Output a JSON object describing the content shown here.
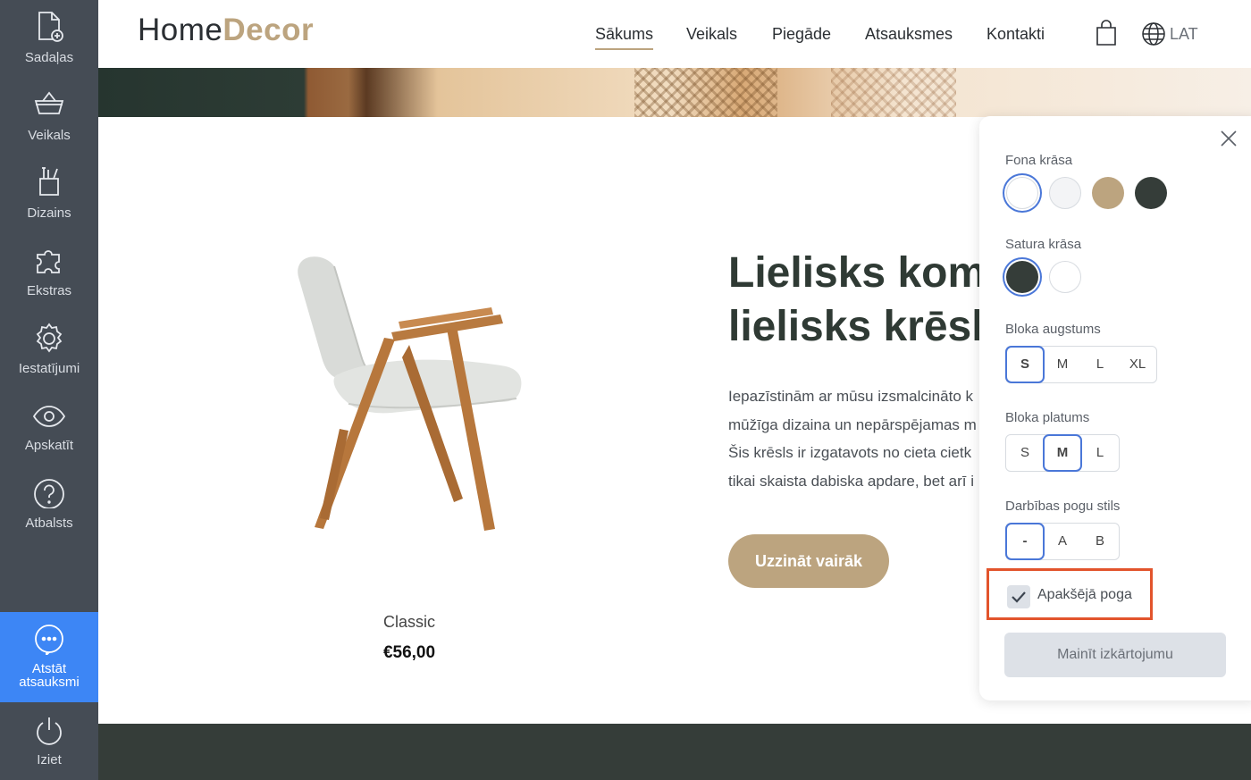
{
  "sidebar": {
    "items": [
      {
        "label": "Sadaļas",
        "icon": "add-page-icon"
      },
      {
        "label": "Veikals",
        "icon": "basket-icon"
      },
      {
        "label": "Dizains",
        "icon": "design-tools-icon"
      },
      {
        "label": "Ekstras",
        "icon": "puzzle-icon"
      },
      {
        "label": "Iestatījumi",
        "icon": "gear-icon"
      },
      {
        "label": "Apskatīt",
        "icon": "eye-icon"
      },
      {
        "label": "Atbalsts",
        "icon": "help-icon"
      }
    ],
    "feedback": {
      "label_line1": "Atstāt",
      "label_line2": "atsauksmi",
      "icon": "chat-bubble-icon"
    },
    "exit": {
      "label": "Iziet",
      "icon": "power-icon"
    }
  },
  "header": {
    "logo_part1": "Home",
    "logo_part2": "Decor",
    "nav": [
      "Sākums",
      "Veikals",
      "Piegāde",
      "Atsauksmes",
      "Kontakti"
    ],
    "active_nav": "Sākums",
    "language": "LAT"
  },
  "product": {
    "name": "Classic",
    "price": "€56,00"
  },
  "hero_text": {
    "headline_line1": "Lielisks komfo",
    "headline_line2": "lielisks krēsls",
    "desc_lines": [
      "Iepazīstinām ar mūsu izsmalcināto k",
      "mūžīga dizaina un nepārspējamas m",
      "Šis krēsls ir izgatavots no cieta cietk",
      "tikai skaista dabiska apdare, bet arī i"
    ],
    "cta": "Uzzināt vairāk"
  },
  "panel": {
    "bg_color_label": "Fona krāsa",
    "bg_colors": [
      "#ffffff",
      "#f3f4f6",
      "#bca47f",
      "#353d39"
    ],
    "bg_selected": 0,
    "content_color_label": "Satura krāsa",
    "content_colors": [
      "#353d39",
      "#ffffff"
    ],
    "content_selected": 0,
    "height_label": "Bloka augstums",
    "height_options": [
      "S",
      "M",
      "L",
      "XL"
    ],
    "height_selected": "S",
    "width_label": "Bloka platums",
    "width_options": [
      "S",
      "M",
      "L"
    ],
    "width_selected": "M",
    "button_style_label": "Darbības pogu stils",
    "button_style_options": [
      "-",
      "A",
      "B"
    ],
    "button_style_selected": "-",
    "bottom_button_label": "Apakšējā poga",
    "bottom_button_checked": true,
    "change_layout": "Mainīt izkārtojumu"
  },
  "colors": {
    "accent": "#bca47f",
    "sidebar": "#454c55",
    "sidebar_active": "#3d86f5",
    "highlight": "#e2542c",
    "select_ring": "#4a77d8"
  }
}
